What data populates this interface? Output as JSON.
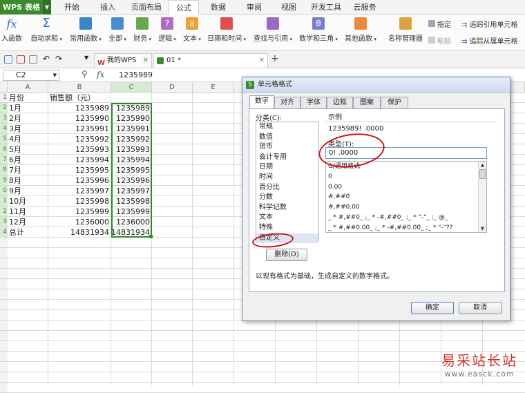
{
  "menubar": {
    "app_button": "WPS 表格",
    "tabs": [
      {
        "label": "开始"
      },
      {
        "label": "插入"
      },
      {
        "label": "页面布局"
      },
      {
        "label": "公式",
        "active": true
      },
      {
        "label": "数据"
      },
      {
        "label": "审阅"
      },
      {
        "label": "视图"
      },
      {
        "label": "开发工具"
      },
      {
        "label": "云服务"
      }
    ]
  },
  "ribbon": {
    "insert_function": "入函数",
    "autosum": "自动求和",
    "common_functions": "常用函数",
    "all": "全部",
    "finance": "财务",
    "logic": "逻辑",
    "text": "文本",
    "datetime": "日期和时间",
    "lookup": "查找与引用",
    "math": "数学和三角",
    "other": "其他函数",
    "name_manager": "名称管理器",
    "specify": "指定",
    "paste": "粘贴",
    "trace_precedents": "追踪引用单元格",
    "trace_dependents": "追踪从属单元格"
  },
  "doctabs": {
    "tab1": "我的WPS",
    "tab2": "01 *"
  },
  "formula_bar": {
    "cell_ref": "C2",
    "fx": "fx",
    "content": "1235989"
  },
  "sheet": {
    "columns": [
      "A",
      "B",
      "C",
      "D",
      "E"
    ],
    "header": {
      "a": "月份",
      "b": "销售额（元）"
    },
    "rows": [
      {
        "a": "1月",
        "b": "1235989",
        "c": "1235989"
      },
      {
        "a": "2月",
        "b": "1235990",
        "c": "1235990"
      },
      {
        "a": "3月",
        "b": "1235991",
        "c": "1235991"
      },
      {
        "a": "4月",
        "b": "1235992",
        "c": "1235992"
      },
      {
        "a": "5月",
        "b": "1235993",
        "c": "1235993"
      },
      {
        "a": "6月",
        "b": "1235994",
        "c": "1235994"
      },
      {
        "a": "7月",
        "b": "1235995",
        "c": "1235995"
      },
      {
        "a": "8月",
        "b": "1235996",
        "c": "1235996"
      },
      {
        "a": "9月",
        "b": "1235997",
        "c": "1235997"
      },
      {
        "a": "10月",
        "b": "1235998",
        "c": "1235998"
      },
      {
        "a": "11月",
        "b": "1235999",
        "c": "1235999"
      },
      {
        "a": "12月",
        "b": "1236000",
        "c": "1236000"
      },
      {
        "a": "总计",
        "b": "14831934",
        "c": "14831934"
      }
    ],
    "row_numbers": [
      "1",
      "2",
      "3",
      "4",
      "5",
      "6",
      "7",
      "8",
      "9",
      "0",
      "1",
      "2",
      "3",
      "4"
    ]
  },
  "dialog": {
    "title": "单元格格式",
    "tabs": [
      "数字",
      "对齐",
      "字体",
      "边框",
      "图案",
      "保护"
    ],
    "category_label": "分类(C):",
    "categories": [
      "常规",
      "数值",
      "货币",
      "会计专用",
      "日期",
      "时间",
      "百分比",
      "分数",
      "科学记数",
      "文本",
      "特殊",
      "自定义"
    ],
    "sample_label": "示例",
    "sample_value": "1235989! .0000",
    "type_label": "类型(T):",
    "type_value": "0! .0000",
    "type_list": [
      "G/通用格式",
      "0",
      "0.00",
      "#,##0",
      "#,##0.00",
      "_ * #,##0_ ;_ * -#,##0_ ;_ * \"-\"_ ;_ @_",
      "_ * #,##0.00_ ;_ * -#,##0.00_ ;_ * \"-\"??"
    ],
    "delete_button": "删除(D)",
    "description": "以现有格式为基础，生成自定义的数字格式。",
    "ok_button": "确定",
    "cancel_button": "取消"
  },
  "watermark": {
    "line1": "易采站长站",
    "line2": "www.easck.com"
  },
  "colors": {
    "wps_green": "#3b8a2c",
    "selection_green": "#2f8a2f",
    "annotation_red": "#d01010",
    "watermark_red": "#d0342c"
  }
}
